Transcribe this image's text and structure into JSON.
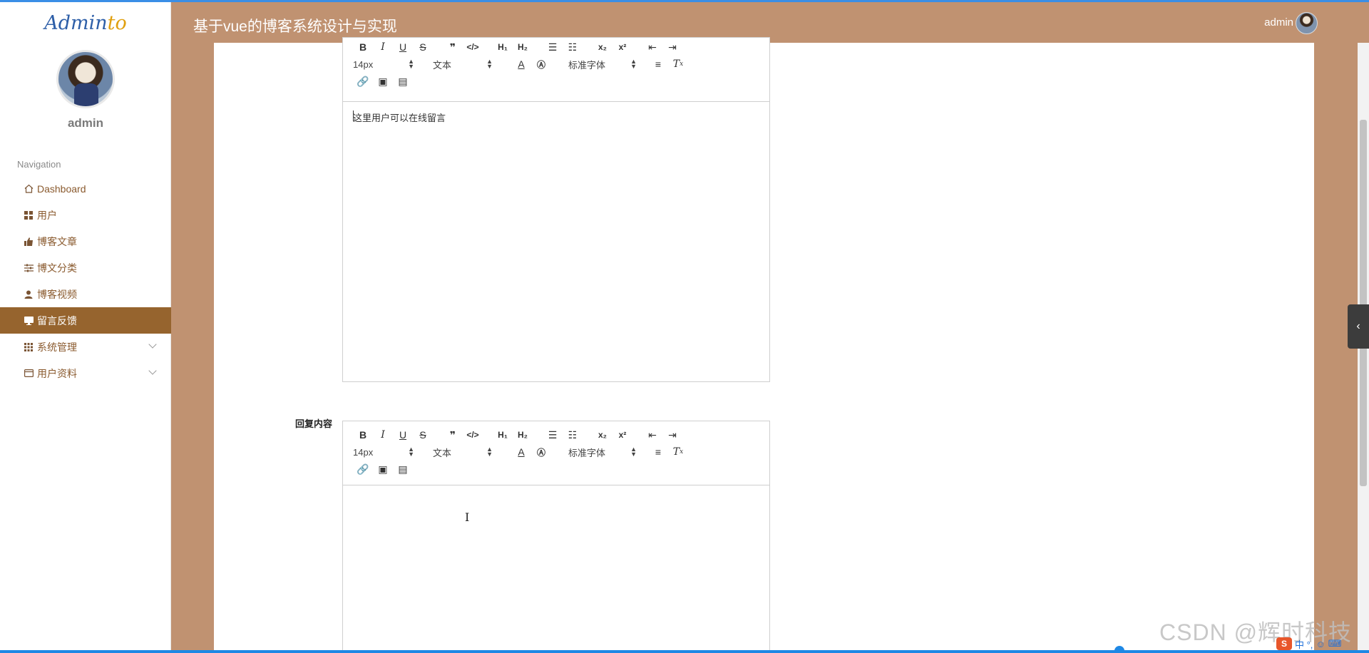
{
  "app": {
    "logo_text": "Admin",
    "logo_accent": "to",
    "user_name": "admin"
  },
  "header": {
    "title": "基于vue的博客系统设计与实现",
    "user": "admin"
  },
  "sidebar": {
    "nav_title": "Navigation",
    "items": [
      {
        "label": "Dashboard",
        "icon": "home-icon"
      },
      {
        "label": "用户",
        "icon": "grid-icon"
      },
      {
        "label": "博客文章",
        "icon": "thumb-icon"
      },
      {
        "label": "博文分类",
        "icon": "sliders-icon"
      },
      {
        "label": "博客视频",
        "icon": "user-icon"
      },
      {
        "label": "留言反馈",
        "icon": "monitor-icon",
        "active": true
      },
      {
        "label": "系统管理",
        "icon": "apps-icon",
        "expandable": true
      },
      {
        "label": "用户资料",
        "icon": "card-icon",
        "expandable": true
      }
    ]
  },
  "editor_toolbar": {
    "size": "14px",
    "header": "文本",
    "font": "标准字体",
    "h1": "H₁",
    "h2": "H₂",
    "sub": "x₂",
    "sup": "x²"
  },
  "form": {
    "message_content": "这里用户可以在线留言",
    "reply_label": "回复内容",
    "reply_content": ""
  },
  "overlay": {
    "watermark": "CSDN @辉时科技",
    "ime_text": "中 °,"
  },
  "colors": {
    "header_bg": "#c09271",
    "active_nav": "#96642e",
    "nav_text": "#8a5a2e"
  }
}
